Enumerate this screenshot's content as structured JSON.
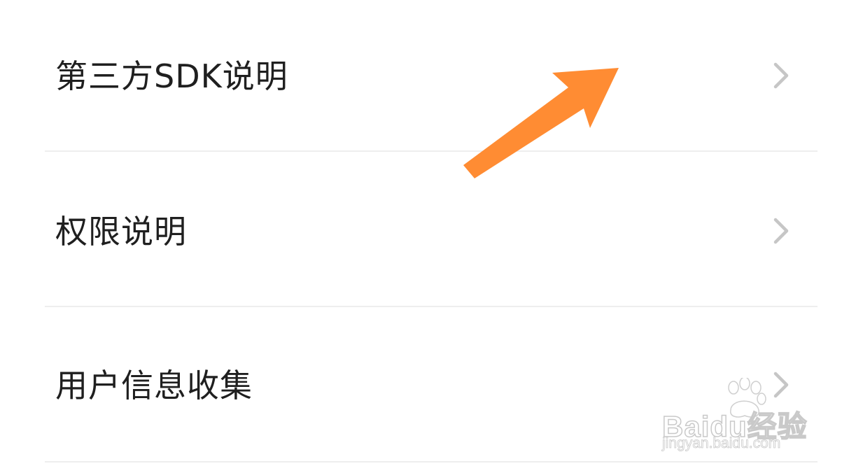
{
  "menu": {
    "items": [
      {
        "label": "第三方SDK说明",
        "icon": "chevron-right-icon"
      },
      {
        "label": "权限说明",
        "icon": "chevron-right-icon"
      },
      {
        "label": "用户信息收集",
        "icon": "chevron-right-icon"
      }
    ]
  },
  "annotation": {
    "icon": "arrow-pointer-icon",
    "color": "#FF8C33"
  },
  "watermark": {
    "brand": "Baidu经验",
    "url": "jingyan.baidu.com",
    "icon": "paw-icon"
  },
  "colors": {
    "background": "#FFFFFF",
    "text": "#1F1F1F",
    "chevron": "#C6C6C6",
    "divider": "#EEEEEE"
  }
}
